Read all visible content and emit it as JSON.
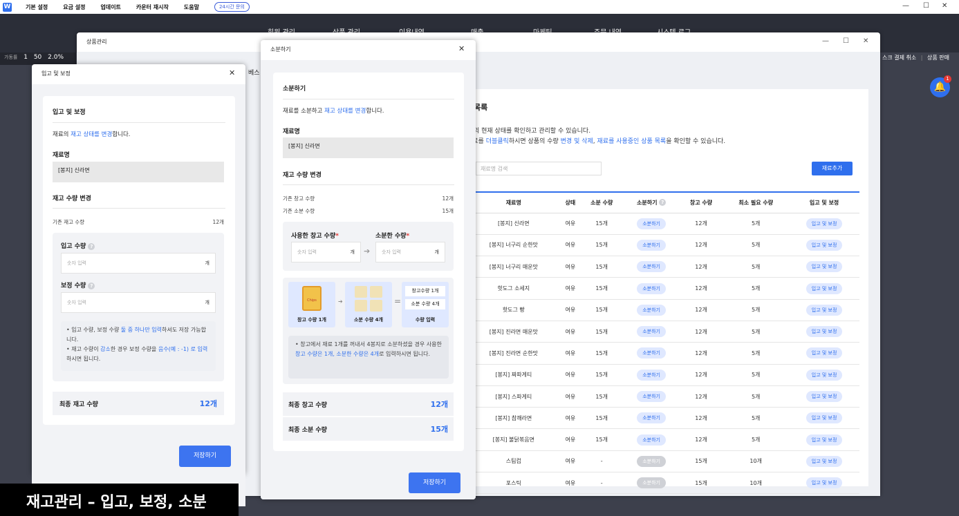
{
  "topbar": {
    "menus": [
      "기본 설정",
      "요금 설정",
      "업데이트",
      "카운터 재시작",
      "도움말"
    ],
    "inquiry": "24시간 문의"
  },
  "appbar": {
    "nav": [
      "회원 관리",
      "상품 관리",
      "이용내역",
      "매출",
      "마케팅",
      "주문 내역",
      "시스템 로그"
    ],
    "stats": [
      "가동률",
      "1",
      "50",
      "2.0%"
    ],
    "right": [
      "스크 결제 취소",
      "상품 판매"
    ]
  },
  "notification": {
    "count": "1"
  },
  "product_window": {
    "title": "상품관리",
    "partial_tab": "베스",
    "card": {
      "heading": "목록",
      "desc1": "의 현재 상태를 확인하고 관리할 수 있습니다.",
      "desc2_parts": [
        "재료를 ",
        "더블클릭",
        "하시면 상품의 수량 ",
        "변경 및 삭제",
        ", ",
        "재료를 사용중인 상품 목록",
        "을 확인할 수 있습니다."
      ],
      "search_placeholder": "재료명 검색",
      "add_button": "재료추가",
      "columns": [
        "재료명",
        "상태",
        "소분 수량",
        "소분하기",
        "창고 수량",
        "최소 필요 수량",
        "입고 및 보정"
      ],
      "rows": [
        {
          "name": "[봉지] 신라면",
          "status": "여유",
          "sub_qty": "15개",
          "split": "소분하기",
          "stock": "12개",
          "min": "5개",
          "action": "입고 및 보정"
        },
        {
          "name": "[봉지] 너구리 순한맛",
          "status": "여유",
          "sub_qty": "15개",
          "split": "소분하기",
          "stock": "12개",
          "min": "5개",
          "action": "입고 및 보정"
        },
        {
          "name": "[봉지] 너구리 매운맛",
          "status": "여유",
          "sub_qty": "15개",
          "split": "소분하기",
          "stock": "12개",
          "min": "5개",
          "action": "입고 및 보정"
        },
        {
          "name": "핫도그 소세지",
          "status": "여유",
          "sub_qty": "15개",
          "split": "소분하기",
          "stock": "12개",
          "min": "5개",
          "action": "입고 및 보정"
        },
        {
          "name": "핫도그 빵",
          "status": "여유",
          "sub_qty": "15개",
          "split": "소분하기",
          "stock": "12개",
          "min": "5개",
          "action": "입고 및 보정"
        },
        {
          "name": "[봉지] 진라면 매운맛",
          "status": "여유",
          "sub_qty": "15개",
          "split": "소분하기",
          "stock": "12개",
          "min": "5개",
          "action": "입고 및 보정"
        },
        {
          "name": "[봉지] 진라면 순한맛",
          "status": "여유",
          "sub_qty": "15개",
          "split": "소분하기",
          "stock": "12개",
          "min": "5개",
          "action": "입고 및 보정"
        },
        {
          "name": "[봉지] 짜파게티",
          "status": "여유",
          "sub_qty": "15개",
          "split": "소분하기",
          "stock": "12개",
          "min": "5개",
          "action": "입고 및 보정"
        },
        {
          "name": "[봉지] 스파게티",
          "status": "여유",
          "sub_qty": "15개",
          "split": "소분하기",
          "stock": "12개",
          "min": "5개",
          "action": "입고 및 보정"
        },
        {
          "name": "[봉지] 참깨라면",
          "status": "여유",
          "sub_qty": "15개",
          "split": "소분하기",
          "stock": "12개",
          "min": "5개",
          "action": "입고 및 보정"
        },
        {
          "name": "[봉지] 불닭볶음면",
          "status": "여유",
          "sub_qty": "15개",
          "split": "소분하기",
          "stock": "12개",
          "min": "5개",
          "action": "입고 및 보정"
        },
        {
          "name": "스팀컵",
          "status": "여유",
          "sub_qty": "-",
          "split": "소분하기",
          "stock": "15개",
          "min": "10개",
          "action": "입고 및 보정",
          "disabled": true
        },
        {
          "name": "포스틱",
          "status": "여유",
          "sub_qty": "-",
          "split": "소분하기",
          "stock": "15개",
          "min": "10개",
          "action": "입고 및 보정",
          "disabled": true
        }
      ]
    }
  },
  "intake_dialog": {
    "title": "입고 및 보정",
    "section": "입고 및 보정",
    "desc_parts": [
      "재료의 ",
      "재고 상태를 변경",
      "합니다."
    ],
    "name_label": "재료명",
    "name_value": "[봉지] 신라면",
    "change_label": "재고 수량 변경",
    "current_label": "기존 재고 수량",
    "current_value": "12개",
    "in_label": "입고 수량",
    "in_placeholder": "숫자 입력",
    "in_unit": "개",
    "adj_label": "보정 수량",
    "adj_placeholder": "숫자 입력",
    "adj_unit": "개",
    "note1_parts": [
      "입고 수량, 보정 수량 ",
      "둘 중 하나만 입력",
      "하셔도 저장 가능합니다."
    ],
    "note2_parts": [
      "재고 수량이 ",
      "감소",
      "한 경우 보정 수량을 ",
      "음수(예 : -1) 로 입력",
      "하시면 됩니다."
    ],
    "final_label": "최종 재고 수량",
    "final_value": "12개",
    "save": "저장하기"
  },
  "split_dialog": {
    "title": "소분하기",
    "section": "소분하기",
    "desc_parts": [
      "재료를 소분하고 ",
      "재고 상태를 변경",
      "합니다."
    ],
    "name_label": "재료명",
    "name_value": "[봉지] 신라면",
    "change_label": "재고 수량 변경",
    "stock_label": "기존 창고 수량",
    "stock_value": "12개",
    "sub_label": "기존 소분 수량",
    "sub_value": "15개",
    "used_label": "사용한 창고 수량",
    "split_label": "소분한 수량",
    "placeholder": "숫자 입력",
    "unit": "개",
    "illus": {
      "package_text": "Chips",
      "box1_caption": "창고 수량 1개",
      "box2_caption": "소분 수량 4개",
      "result_line1": "창고수량 1개",
      "result_line2": "소분 수량 4개",
      "result_caption": "수량 입력"
    },
    "note_parts": [
      "창고에서 재료 1개를 꺼내서 4봉지로 소분하셨을 경우 사용한 ",
      "창고 수량은 1개, 소분한 수량은 4개",
      "로 입력하시면 됩니다."
    ],
    "final_stock_label": "최종 창고 수량",
    "final_stock_value": "12개",
    "final_sub_label": "최종 소분 수량",
    "final_sub_value": "15개",
    "save": "저장하기"
  },
  "caption": "재고관리 – 입고, 보정, 소분",
  "colors": {
    "accent": "#2f6fed",
    "dark": "#2b2e38"
  }
}
